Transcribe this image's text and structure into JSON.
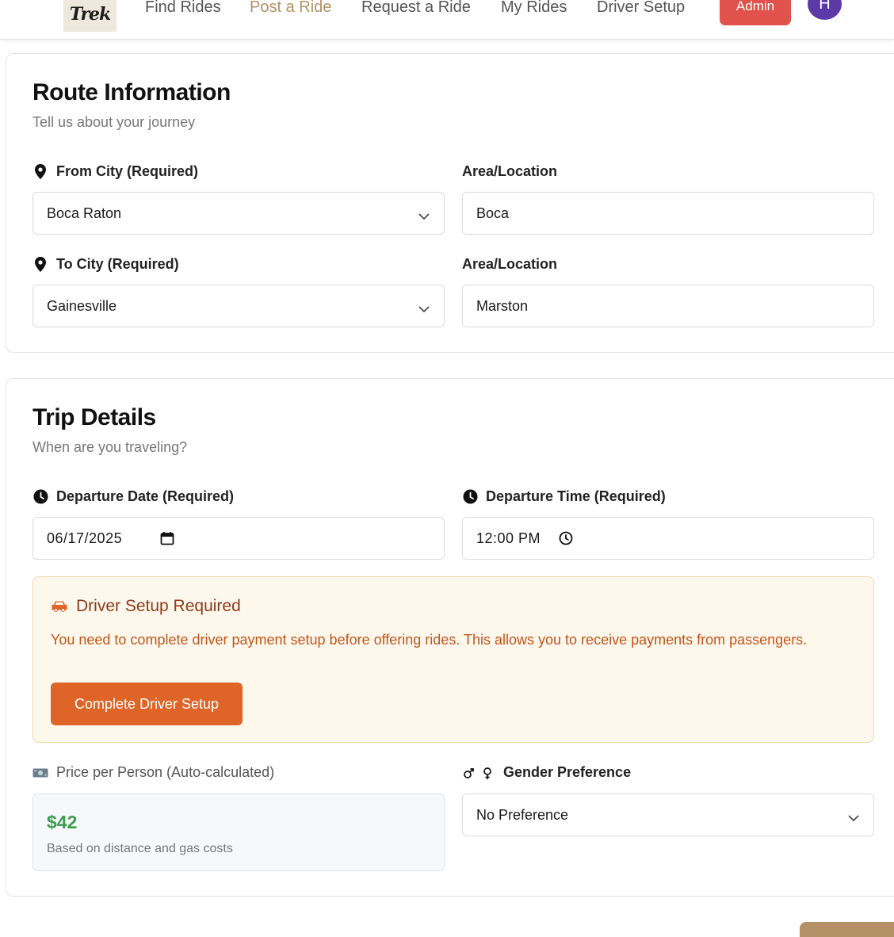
{
  "header": {
    "logo_text": "Trek",
    "nav": [
      {
        "label": "Find Rides"
      },
      {
        "label": "Post a Ride"
      },
      {
        "label": "Request a Ride"
      },
      {
        "label": "My Rides"
      },
      {
        "label": "Driver Setup"
      }
    ],
    "active_nav": "Post a Ride",
    "admin_label": "Admin",
    "avatar_initial": "H"
  },
  "route": {
    "title": "Route Information",
    "subtitle": "Tell us about your journey",
    "from_label": "From City (Required)",
    "from_value": "Boca Raton",
    "from_area_label": "Area/Location",
    "from_area_value": "Boca",
    "to_label": "To City (Required)",
    "to_value": "Gainesville",
    "to_area_label": "Area/Location",
    "to_area_value": "Marston"
  },
  "trip": {
    "title": "Trip Details",
    "subtitle": "When are you traveling?",
    "date_label": "Departure Date (Required)",
    "date_value": "06/17/2025",
    "time_label": "Departure Time (Required)",
    "time_value": "12:00 PM",
    "alert": {
      "title": "Driver Setup Required",
      "text": "You need to complete driver payment setup before offering rides. This allows you to receive payments from passengers.",
      "button_label": "Complete Driver Setup"
    },
    "price_label": "Price per Person (Auto-calculated)",
    "price_value": "$42",
    "price_note": "Based on distance and gas costs",
    "gender_label": "Gender Preference",
    "gender_value": "No Preference"
  },
  "colors": {
    "accent": "#b39066",
    "admin": "#e0524b",
    "avatar": "#5b3aa8",
    "alert_button": "#de6427",
    "price": "#3f9b4f"
  },
  "icons": [
    "location-pin-icon",
    "clock-icon",
    "calendar-icon",
    "car-icon",
    "money-icon",
    "gender-icon",
    "chevron-down-icon"
  ]
}
